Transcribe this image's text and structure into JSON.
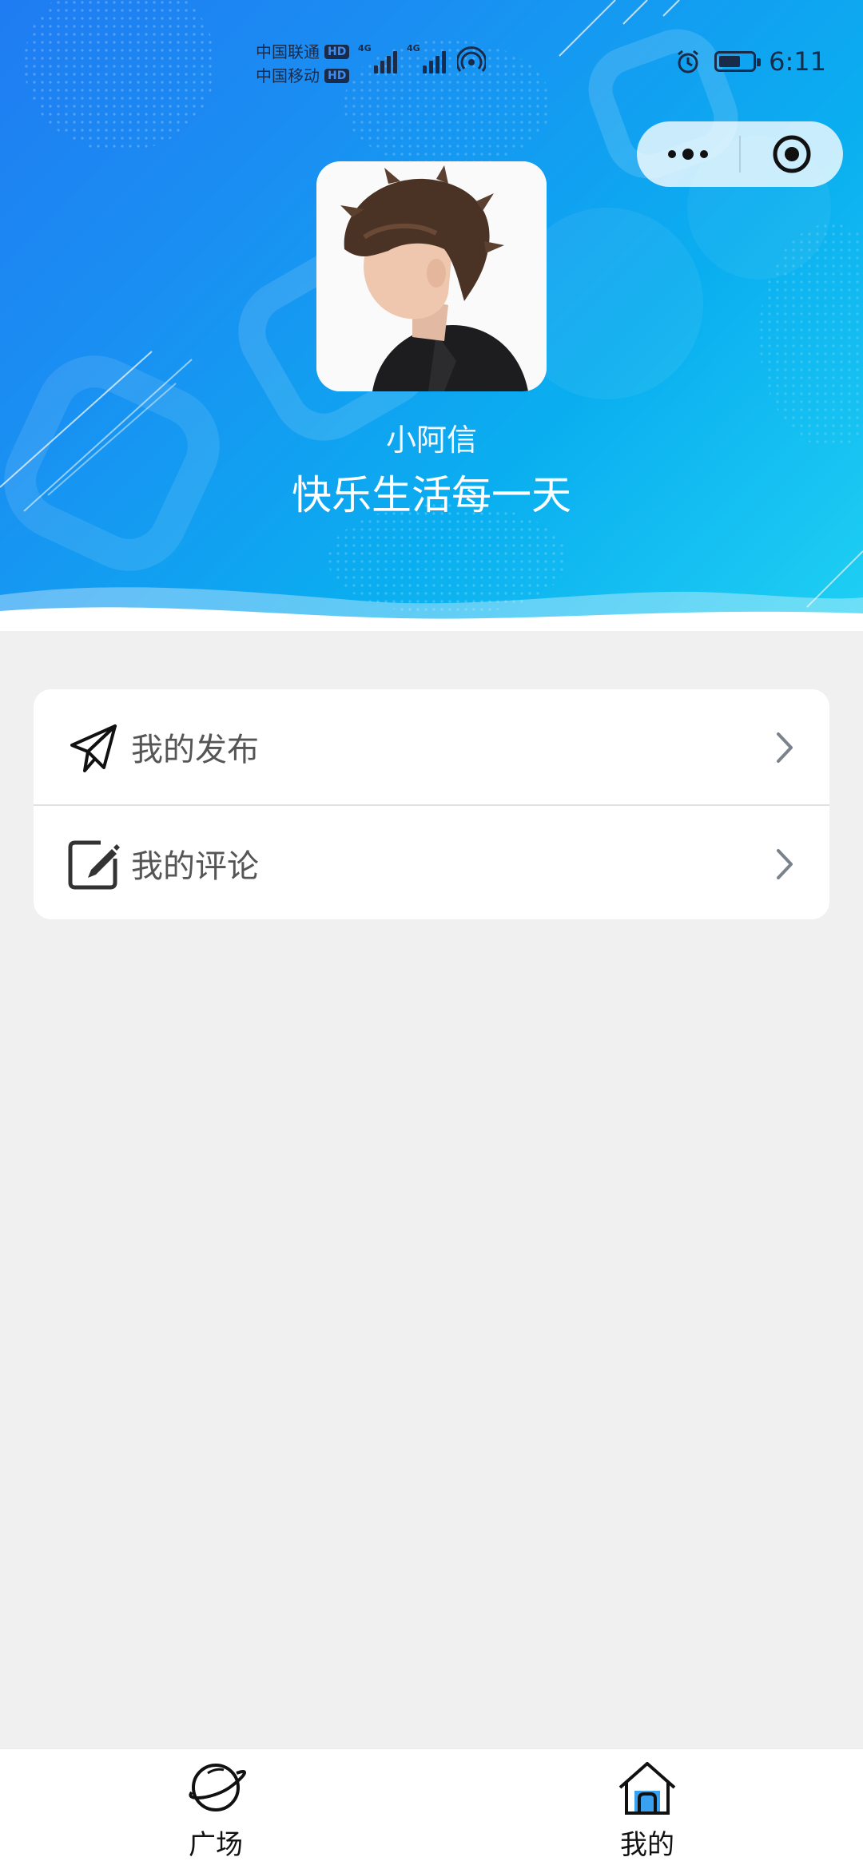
{
  "status_bar": {
    "carrier1": "中国联通",
    "carrier2": "中国移动",
    "hd_label": "HD",
    "network1": "4G",
    "network2": "4G",
    "time": "6:11"
  },
  "profile": {
    "name": "小阿信",
    "motto": "快乐生活每一天"
  },
  "menu": {
    "items": [
      {
        "label": "我的发布",
        "icon": "send-icon"
      },
      {
        "label": "我的评论",
        "icon": "edit-icon"
      }
    ]
  },
  "tabbar": {
    "tabs": [
      {
        "label": "广场",
        "icon": "planet-icon",
        "active": false
      },
      {
        "label": "我的",
        "icon": "home-icon",
        "active": true
      }
    ]
  },
  "colors": {
    "header_start": "#1f7cf2",
    "header_end": "#1fd0f3",
    "page_bg": "#f0f0f0",
    "active_tab_accent": "#3aa0f0"
  }
}
